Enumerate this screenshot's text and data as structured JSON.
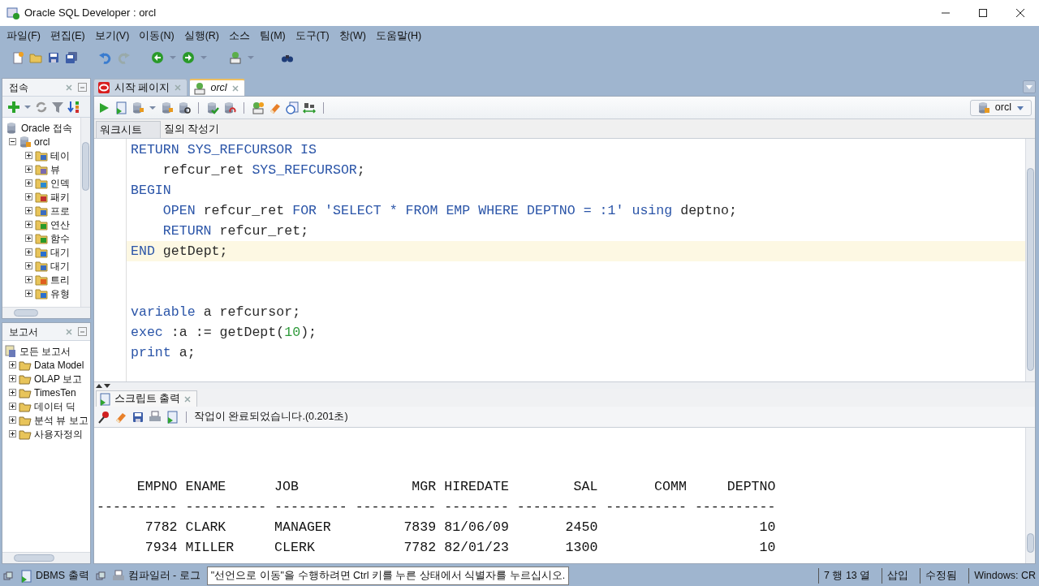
{
  "window": {
    "title": "Oracle SQL Developer : orcl"
  },
  "menu": [
    "파일(F)",
    "편집(E)",
    "보기(V)",
    "이동(N)",
    "실행(R)",
    "소스",
    "팀(M)",
    "도구(T)",
    "창(W)",
    "도움말(H)"
  ],
  "connections_panel": {
    "title": "접속",
    "tree": [
      {
        "label": "Oracle 접속",
        "children": [
          {
            "label": "orcl",
            "expanded": true,
            "children": [
              {
                "label": "테이",
                "expanded": false
              },
              {
                "label": "뷰",
                "expanded": false
              },
              {
                "label": "인덱",
                "expanded": false
              },
              {
                "label": "패키",
                "expanded": false
              },
              {
                "label": "프로",
                "expanded": false
              },
              {
                "label": "연산",
                "expanded": false
              },
              {
                "label": "함수",
                "expanded": false
              },
              {
                "label": "대기",
                "expanded": false
              },
              {
                "label": "대기",
                "expanded": false
              },
              {
                "label": "트리",
                "expanded": false
              },
              {
                "label": "유형",
                "expanded": false
              }
            ]
          }
        ]
      }
    ]
  },
  "reports_panel": {
    "title": "보고서",
    "tree": [
      {
        "label": "모든 보고서",
        "children": [
          {
            "label": "Data Model",
            "expanded": false
          },
          {
            "label": "OLAP 보고",
            "expanded": false
          },
          {
            "label": "TimesTen",
            "expanded": false
          },
          {
            "label": "데이터 딕",
            "expanded": false
          },
          {
            "label": "분석 뷰 보고",
            "expanded": false
          },
          {
            "label": "사용자정의",
            "expanded": false
          }
        ]
      }
    ]
  },
  "document_tabs": [
    {
      "label": "시작 페이지",
      "selected": false
    },
    {
      "label": "orcl",
      "selected": true
    }
  ],
  "connection_selector": {
    "value": "orcl"
  },
  "editor_tabs": [
    {
      "label": "워크시트",
      "selected": true
    },
    {
      "label": "질의 작성기",
      "selected": false
    }
  ],
  "code": [
    {
      "current": false,
      "segments": [
        {
          "text": "RETURN SYS_REFCURSOR IS",
          "kind": "kw"
        }
      ]
    },
    {
      "current": false,
      "segments": [
        {
          "text": "    refcur_ret ",
          "kind": "plain"
        },
        {
          "text": "SYS_REFCURSOR",
          "kind": "kw"
        },
        {
          "text": ";",
          "kind": "plain"
        }
      ]
    },
    {
      "current": false,
      "segments": [
        {
          "text": "BEGIN",
          "kind": "kw"
        }
      ]
    },
    {
      "current": false,
      "segments": [
        {
          "text": "    OPEN ",
          "kind": "kw"
        },
        {
          "text": "refcur_ret ",
          "kind": "plain"
        },
        {
          "text": "FOR ",
          "kind": "kw"
        },
        {
          "text": "'SELECT * FROM EMP WHERE DEPTNO = :1'",
          "kind": "str"
        },
        {
          "text": " using ",
          "kind": "kw"
        },
        {
          "text": "deptno;",
          "kind": "plain"
        }
      ]
    },
    {
      "current": false,
      "segments": [
        {
          "text": "    RETURN ",
          "kind": "kw"
        },
        {
          "text": "refcur_ret;",
          "kind": "plain"
        }
      ]
    },
    {
      "current": true,
      "segments": [
        {
          "text": "END ",
          "kind": "kw"
        },
        {
          "text": "getDept;",
          "kind": "plain"
        }
      ]
    },
    {
      "current": false
    },
    {
      "current": false
    },
    {
      "current": false,
      "segments": [
        {
          "text": "variable ",
          "kind": "kw"
        },
        {
          "text": "a refcursor;",
          "kind": "plain"
        }
      ]
    },
    {
      "current": false,
      "segments": [
        {
          "text": "exec ",
          "kind": "kw"
        },
        {
          "text": ":a := getDept(",
          "kind": "plain"
        },
        {
          "text": "10",
          "kind": "num"
        },
        {
          "text": ");",
          "kind": "plain"
        }
      ]
    },
    {
      "current": false,
      "segments": [
        {
          "text": "print ",
          "kind": "kw"
        },
        {
          "text": "a;",
          "kind": "plain"
        }
      ]
    }
  ],
  "output_panel": {
    "tab": "스크립트 출력",
    "message": "작업이 완료되었습니다.(0.201초)",
    "lines": [
      "     EMPNO ENAME      JOB              MGR HIREDATE        SAL       COMM     DEPTNO",
      "---------- ---------- --------- ---------- -------- ---------- ---------- ----------",
      "      7782 CLARK      MANAGER         7839 81/06/09       2450                    10",
      "      7934 MILLER     CLERK           7782 82/01/23       1300                    10"
    ]
  },
  "status_bar": {
    "tabs": [
      "DBMS 출력",
      "컴파일러 - 로그"
    ],
    "message": "\"선언으로 이동\"을 수행하려면 Ctrl 키를 누른 상태에서 식별자를 누르십시오.",
    "position": "7 행 13 열",
    "mode": "삽입",
    "modified": "수정됨",
    "line_ending": "Windows: CR"
  }
}
